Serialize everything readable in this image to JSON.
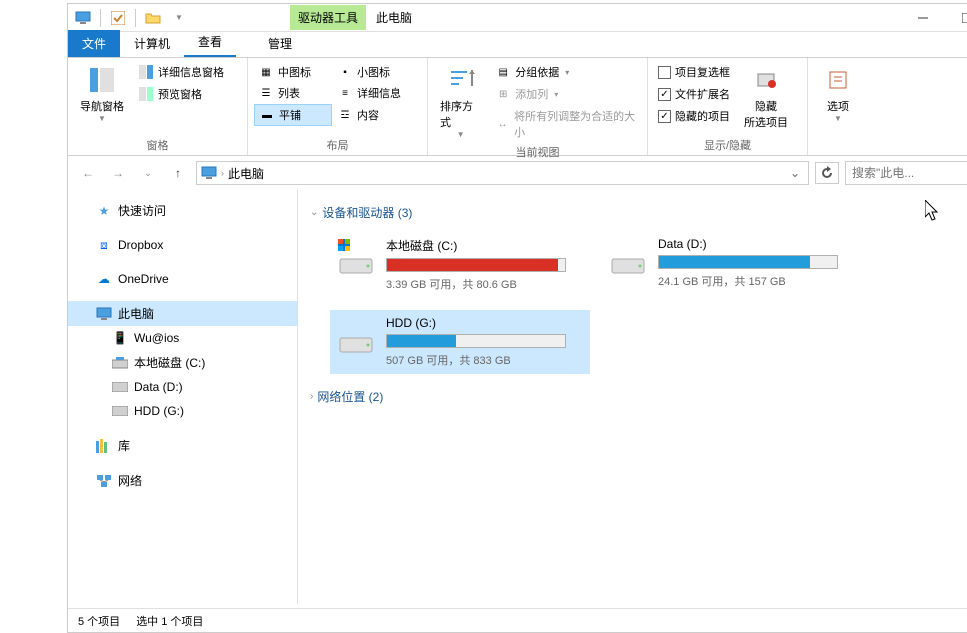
{
  "titlebar": {
    "tool_tab": "驱动器工具",
    "title": "此电脑"
  },
  "tabs": {
    "file": "文件",
    "computer": "计算机",
    "view": "查看",
    "manage": "管理"
  },
  "ribbon": {
    "panes": {
      "nav_pane": "导航窗格",
      "preview_pane": "预览窗格",
      "detail_pane": "详细信息窗格",
      "group": "窗格"
    },
    "layout": {
      "medium_icons": "中图标",
      "small_icons": "小图标",
      "list": "列表",
      "details": "详细信息",
      "tiles": "平铺",
      "content": "内容",
      "group": "布局"
    },
    "current_view": {
      "sort": "排序方式",
      "group_by": "分组依据",
      "add_columns": "添加列",
      "fit_columns": "将所有列调整为合适的大小",
      "group": "当前视图"
    },
    "show_hide": {
      "item_checkboxes": "项目复选框",
      "file_extensions": "文件扩展名",
      "hidden_items": "隐藏的项目",
      "hide_selected": "隐藏所选项目",
      "hide": "隐藏",
      "group": "显示/隐藏"
    },
    "options": "选项"
  },
  "breadcrumb": {
    "path": "此电脑"
  },
  "search": {
    "placeholder": "搜索\"此电..."
  },
  "sidebar": {
    "quick_access": "快速访问",
    "dropbox": "Dropbox",
    "onedrive": "OneDrive",
    "this_pc": "此电脑",
    "wu_ios": "Wu@ios",
    "local_disk_c": "本地磁盘 (C:)",
    "data_d": "Data (D:)",
    "hdd_g": "HDD (G:)",
    "libraries": "库",
    "network": "网络"
  },
  "content": {
    "devices_header": "设备和驱动器 (3)",
    "network_header": "网络位置 (2)",
    "drives": [
      {
        "name": "本地磁盘 (C:)",
        "status": "3.39 GB 可用，共 80.6 GB",
        "fill_pct": 96,
        "color": "#d93025"
      },
      {
        "name": "Data (D:)",
        "status": "24.1 GB 可用，共 157 GB",
        "fill_pct": 85,
        "color": "#239cdc"
      },
      {
        "name": "HDD (G:)",
        "status": "507 GB 可用，共 833 GB",
        "fill_pct": 39,
        "color": "#239cdc"
      }
    ]
  },
  "statusbar": {
    "items": "5 个项目",
    "selected": "选中 1 个项目"
  },
  "checkstates": {
    "item_checkboxes": false,
    "file_extensions": true,
    "hidden_items": true
  }
}
